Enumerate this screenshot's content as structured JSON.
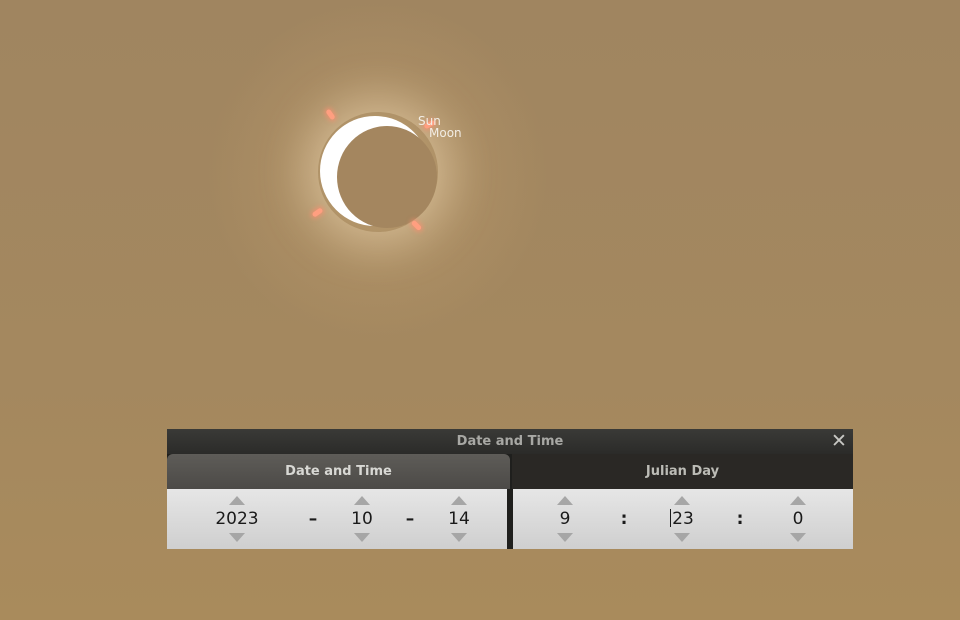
{
  "sky": {
    "sun_label": "Sun",
    "moon_label": "Moon",
    "background_color": "#a3875f",
    "sun_color": "#ffffff",
    "prominence_color": "#ff9f80"
  },
  "dialog": {
    "title": "Date and Time",
    "close_glyph": "✕",
    "tabs": [
      {
        "label": "Date and Time"
      },
      {
        "label": "Julian Day"
      }
    ],
    "date": {
      "year": "2023",
      "month": "10",
      "day": "14",
      "separator": "–"
    },
    "time": {
      "hour": "9",
      "minute": "23",
      "second": "0",
      "separator": ":"
    }
  }
}
